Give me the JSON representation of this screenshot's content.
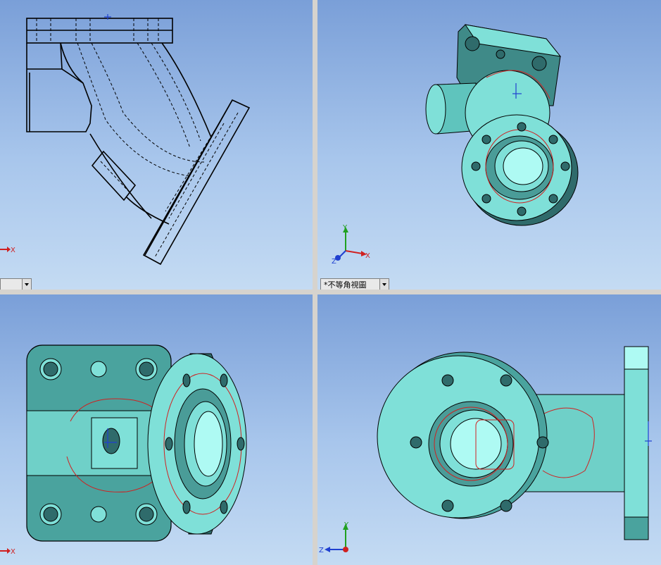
{
  "viewports": [
    {
      "id": "top-left",
      "view_name": "",
      "axis_labels": {
        "x": "X"
      }
    },
    {
      "id": "top-right",
      "view_name": "*不等角視圖",
      "axis_labels": {
        "x": "X",
        "y": "Y",
        "z": "Z"
      }
    },
    {
      "id": "bottom-left",
      "view_name": "",
      "axis_labels": {
        "x": "X"
      }
    },
    {
      "id": "bottom-right",
      "view_name": "",
      "axis_labels": {
        "y": "Y",
        "z": "Z"
      }
    }
  ],
  "colors": {
    "background_top": "#7a9fd8",
    "background_bottom": "#c4dbf3",
    "part_face": "#7fe0d8",
    "part_shade": "#2f6b6b",
    "edge": "#000000",
    "sketch_edge": "#d02020",
    "axis_x": "#d02020",
    "axis_y": "#20a020",
    "axis_z": "#2040d0"
  },
  "icons": [
    "dropdown-arrow-icon",
    "coordinate-triad-icon",
    "origin-marker-icon"
  ]
}
